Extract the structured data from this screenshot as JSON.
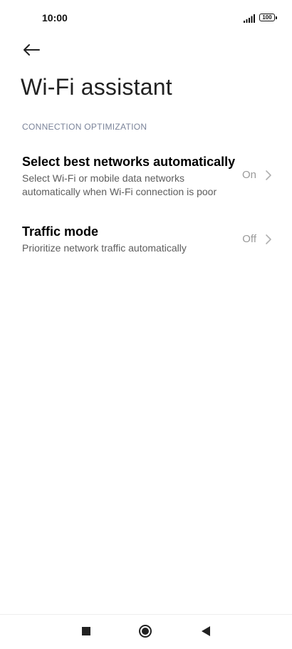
{
  "status_bar": {
    "time": "10:00",
    "battery": "100",
    "icons": [
      "signal-icon",
      "battery-icon"
    ]
  },
  "header": {
    "back_icon": "arrow-left-icon",
    "title": "Wi-Fi assistant"
  },
  "section": {
    "header": "CONNECTION OPTIMIZATION",
    "items": [
      {
        "title": "Select best networks automatically",
        "description": "Select Wi-Fi or mobile data networks automatically when Wi-Fi connection is poor",
        "value": "On",
        "icon": "chevron-right-icon"
      },
      {
        "title": "Traffic mode",
        "description": "Prioritize network traffic automatically",
        "value": "Off",
        "icon": "chevron-right-icon"
      }
    ]
  },
  "nav_bar": {
    "icons": [
      "recents-icon",
      "home-icon",
      "back-icon"
    ]
  }
}
